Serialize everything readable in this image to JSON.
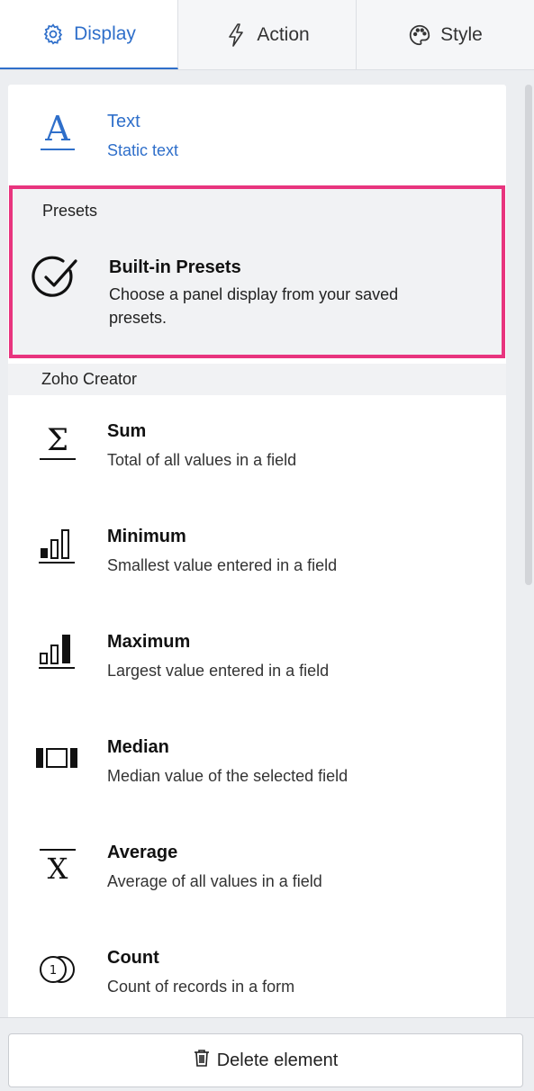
{
  "tabs": [
    {
      "label": "Display",
      "icon": "gear-icon",
      "active": true
    },
    {
      "label": "Action",
      "icon": "lightning-icon",
      "active": false
    },
    {
      "label": "Style",
      "icon": "palette-icon",
      "active": false
    }
  ],
  "text_item": {
    "title": "Text",
    "desc": "Static text",
    "icon": "text-a-icon"
  },
  "presets": {
    "section": "Presets",
    "title": "Built-in Presets",
    "desc_line1": "Choose a panel display from your saved",
    "desc_line2": "presets.",
    "icon": "check-circle-icon"
  },
  "zoho_section": "Zoho Creator",
  "items": [
    {
      "title": "Sum",
      "desc": "Total of all values in a field",
      "icon": "sigma-icon"
    },
    {
      "title": "Minimum",
      "desc": "Smallest value entered in a field",
      "icon": "min-bars-icon"
    },
    {
      "title": "Maximum",
      "desc": "Largest value entered in a field",
      "icon": "max-bars-icon"
    },
    {
      "title": "Median",
      "desc": "Median value of the selected field",
      "icon": "median-icon"
    },
    {
      "title": "Average",
      "desc": "Average of all values in a field",
      "icon": "x-bar-icon"
    },
    {
      "title": "Count",
      "desc": "Count of records in a form",
      "icon": "count-icon"
    }
  ],
  "footer": {
    "delete_label": "Delete element",
    "icon": "trash-icon"
  },
  "colors": {
    "accent": "#2f6fca",
    "highlight": "#e8347e"
  }
}
